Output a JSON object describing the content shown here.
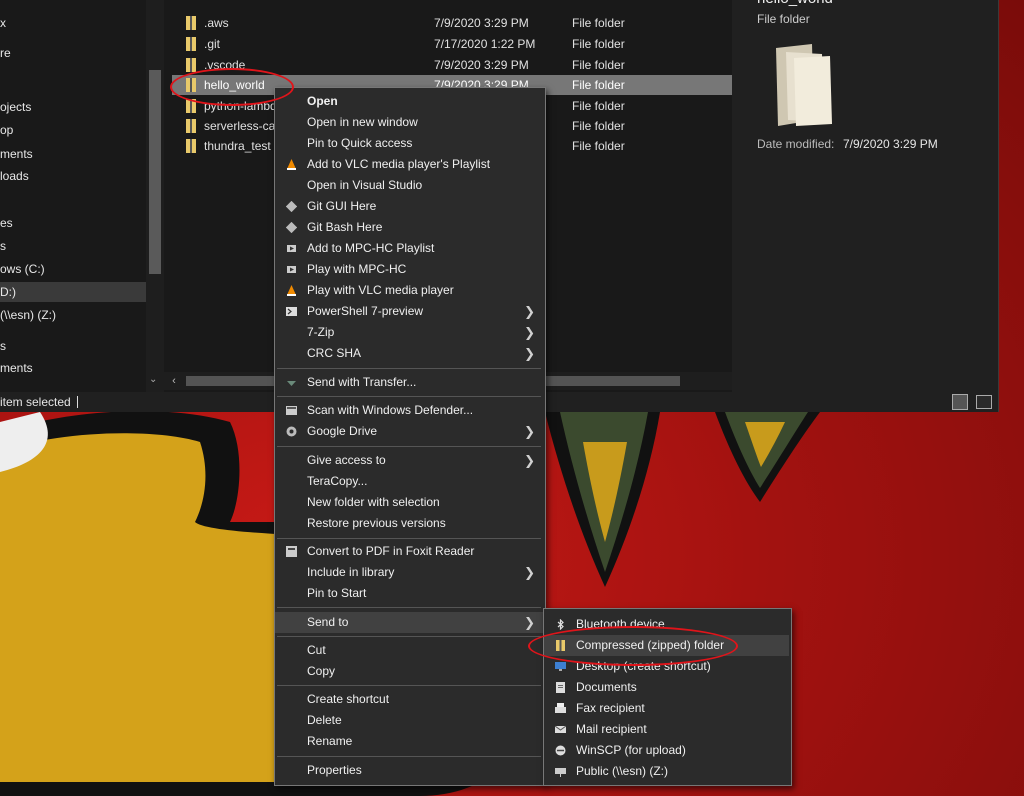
{
  "nav": {
    "items": [
      {
        "label": "x"
      },
      {
        "label": "re"
      },
      {
        "label": "ojects"
      },
      {
        "label": "op"
      },
      {
        "label": "ments"
      },
      {
        "label": "loads"
      },
      {
        "label": "es"
      },
      {
        "label": "s"
      },
      {
        "label": "ows (C:)"
      },
      {
        "label": "D:)"
      },
      {
        "label": "(\\\\esn) (Z:)"
      },
      {
        "label": "s"
      },
      {
        "label": "ments"
      }
    ]
  },
  "files": [
    {
      "name": ".aws",
      "date": "7/9/2020 3:29 PM",
      "type": "File folder"
    },
    {
      "name": ".git",
      "date": "7/17/2020 1:22 PM",
      "type": "File folder"
    },
    {
      "name": ".vscode",
      "date": "7/9/2020 3:29 PM",
      "type": "File folder"
    },
    {
      "name": "hello_world",
      "date": "7/9/2020 3:29 PM",
      "type": "File folder"
    },
    {
      "name": "python-lambda",
      "date": "",
      "type": "File folder"
    },
    {
      "name": "serverless-calc",
      "date": "",
      "type": "File folder"
    },
    {
      "name": "thundra_test",
      "date": "",
      "type": "File folder"
    }
  ],
  "preview": {
    "title": "hello_world",
    "type": "File folder",
    "date_label": "Date modified:",
    "date_value": "7/9/2020 3:29 PM"
  },
  "status": {
    "text": "item selected"
  },
  "context_menu": {
    "items": [
      {
        "label": "Open",
        "icon": ""
      },
      {
        "label": "Open in new window",
        "icon": ""
      },
      {
        "label": "Pin to Quick access",
        "icon": ""
      },
      {
        "label": "Add to VLC media player's Playlist",
        "icon": "vlc-icon"
      },
      {
        "label": "Open in Visual Studio",
        "icon": ""
      },
      {
        "label": "Git GUI Here",
        "icon": "git-icon"
      },
      {
        "label": "Git Bash Here",
        "icon": "git-icon"
      },
      {
        "label": "Add to MPC-HC Playlist",
        "icon": "mpc-icon"
      },
      {
        "label": "Play with MPC-HC",
        "icon": "mpc-icon"
      },
      {
        "label": "Play with VLC media player",
        "icon": "vlc-icon"
      },
      {
        "label": "PowerShell 7-preview",
        "icon": "powershell-icon"
      },
      {
        "label": "7-Zip",
        "icon": ""
      },
      {
        "label": "CRC SHA",
        "icon": ""
      },
      {
        "label": "Send with Transfer...",
        "icon": "transfer-icon"
      },
      {
        "label": "Scan with Windows Defender...",
        "icon": "defender-icon"
      },
      {
        "label": "Google Drive",
        "icon": "google-drive-icon"
      },
      {
        "label": "Give access to",
        "icon": ""
      },
      {
        "label": "TeraCopy...",
        "icon": ""
      },
      {
        "label": "New folder with selection",
        "icon": ""
      },
      {
        "label": "Restore previous versions",
        "icon": ""
      },
      {
        "label": "Convert to PDF in Foxit Reader",
        "icon": "foxit-icon"
      },
      {
        "label": "Include in library",
        "icon": ""
      },
      {
        "label": "Pin to Start",
        "icon": ""
      },
      {
        "label": "Send to",
        "icon": ""
      },
      {
        "label": "Cut",
        "icon": ""
      },
      {
        "label": "Copy",
        "icon": ""
      },
      {
        "label": "Create shortcut",
        "icon": ""
      },
      {
        "label": "Delete",
        "icon": ""
      },
      {
        "label": "Rename",
        "icon": ""
      },
      {
        "label": "Properties",
        "icon": ""
      }
    ]
  },
  "sendto_menu": {
    "items": [
      {
        "label": "Bluetooth device",
        "icon": "bluetooth-icon"
      },
      {
        "label": "Compressed (zipped) folder",
        "icon": "zip-folder-icon"
      },
      {
        "label": "Desktop (create shortcut)",
        "icon": "desktop-icon"
      },
      {
        "label": "Documents",
        "icon": "documents-icon"
      },
      {
        "label": "Fax recipient",
        "icon": "fax-icon"
      },
      {
        "label": "Mail recipient",
        "icon": "mail-icon"
      },
      {
        "label": "WinSCP (for upload)",
        "icon": "winscp-icon"
      },
      {
        "label": "Public (\\\\esn) (Z:)",
        "icon": "network-drive-icon"
      }
    ]
  },
  "colors": {
    "window_bg": "#202020",
    "menu_bg": "#2b2b2b",
    "highlight": "#414141",
    "annotation_red": "#e0141a",
    "folder_yellow": "#e8c96a"
  }
}
